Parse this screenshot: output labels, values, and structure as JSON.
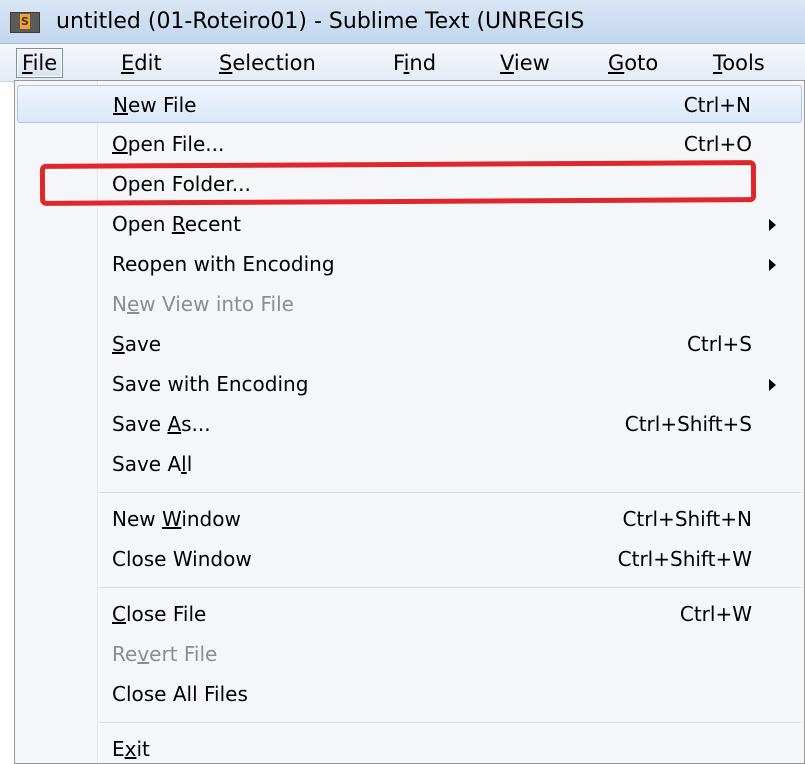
{
  "window": {
    "title": "untitled (01-Roteiro01) - Sublime Text (UNREGIS",
    "icon": "sublime-text-app-icon"
  },
  "menubar": {
    "items": [
      {
        "pre": "",
        "key": "F",
        "post": "ile",
        "active": true
      },
      {
        "pre": "",
        "key": "E",
        "post": "dit"
      },
      {
        "pre": "",
        "key": "S",
        "post": "election"
      },
      {
        "pre": "F",
        "key": "i",
        "post": "nd"
      },
      {
        "pre": "",
        "key": "V",
        "post": "iew"
      },
      {
        "pre": "",
        "key": "G",
        "post": "oto"
      },
      {
        "pre": "",
        "key": "T",
        "post": "ools"
      }
    ]
  },
  "file_menu": {
    "items": [
      {
        "pre": "",
        "key": "N",
        "post": "ew File",
        "shortcut": "Ctrl+N",
        "hover": true
      },
      {
        "pre": "",
        "key": "O",
        "post": "pen File...",
        "shortcut": "Ctrl+O"
      },
      {
        "pre": "Open Folder...",
        "key": "",
        "post": "",
        "shortcut": "",
        "annotated": true
      },
      {
        "pre": "Open ",
        "key": "R",
        "post": "ecent",
        "submenu": true
      },
      {
        "pre": "Reopen with Encoding",
        "key": "",
        "post": "",
        "submenu": true
      },
      {
        "pre": "N",
        "key": "e",
        "post": "w View into File",
        "disabled": true
      },
      {
        "pre": "",
        "key": "S",
        "post": "ave",
        "shortcut": "Ctrl+S"
      },
      {
        "pre": "Save with Encoding",
        "key": "",
        "post": "",
        "submenu": true
      },
      {
        "pre": "Save ",
        "key": "A",
        "post": "s...",
        "shortcut": "Ctrl+Shift+S"
      },
      {
        "pre": "Save A",
        "key": "l",
        "post": "l"
      },
      {
        "separator": true
      },
      {
        "pre": "New ",
        "key": "W",
        "post": "indow",
        "shortcut": "Ctrl+Shift+N"
      },
      {
        "pre": "Close Window",
        "key": "",
        "post": "",
        "shortcut": "Ctrl+Shift+W"
      },
      {
        "separator": true
      },
      {
        "pre": "",
        "key": "C",
        "post": "lose File",
        "shortcut": "Ctrl+W"
      },
      {
        "pre": "Re",
        "key": "v",
        "post": "ert File",
        "disabled": true
      },
      {
        "pre": "Close All Files",
        "key": "",
        "post": ""
      },
      {
        "separator": true
      },
      {
        "pre": "E",
        "key": "x",
        "post": "it"
      }
    ]
  },
  "colors": {
    "annotation": "#e0252b",
    "disabled_text": "#8d8d8d",
    "hover_border": "#a9c5ea"
  }
}
